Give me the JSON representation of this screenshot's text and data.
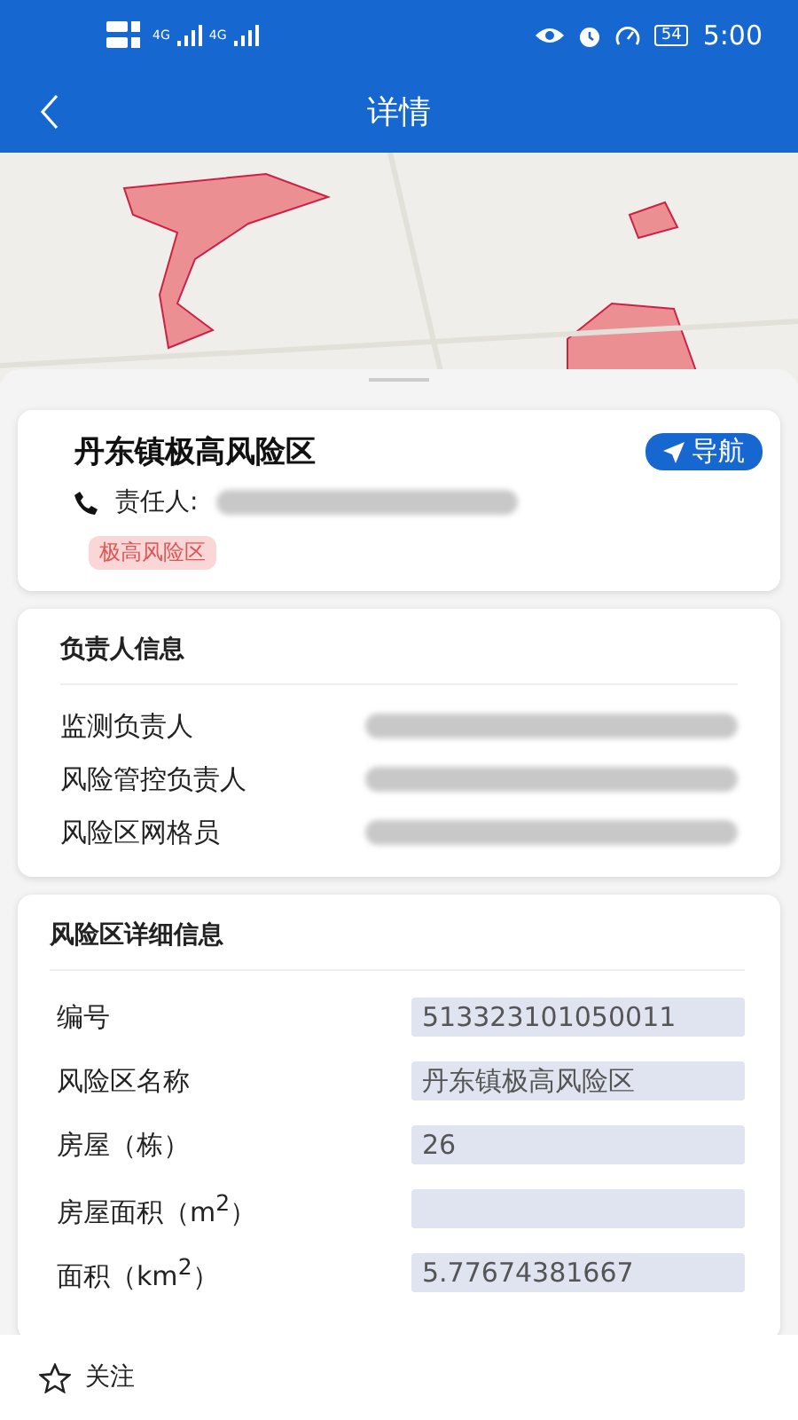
{
  "status_bar": {
    "network_1": "4G",
    "network_2": "4G",
    "battery": "54",
    "time": "5:00"
  },
  "header": {
    "title": "详情"
  },
  "summary": {
    "name": "丹东镇极高风险区",
    "nav_button": "导航",
    "contact_label": "责任人:",
    "tag": "极高风险区"
  },
  "people": {
    "title": "负责人信息",
    "rows": [
      {
        "label": "监测负责人"
      },
      {
        "label": "风险管控负责人"
      },
      {
        "label": "风险区网格员"
      }
    ]
  },
  "details": {
    "title": "风险区详细信息",
    "fields": [
      {
        "label": "编号",
        "value": "513323101050011"
      },
      {
        "label": "风险区名称",
        "value": "丹东镇极高风险区"
      },
      {
        "label": "房屋（栋）",
        "value": "26"
      },
      {
        "label": "房屋面积（m$^{2}$）"
      },
      {
        "label": "面积（km$^{2}$）",
        "value": "5.77674381667"
      }
    ]
  },
  "bottom_bar": {
    "follow": "关注"
  }
}
